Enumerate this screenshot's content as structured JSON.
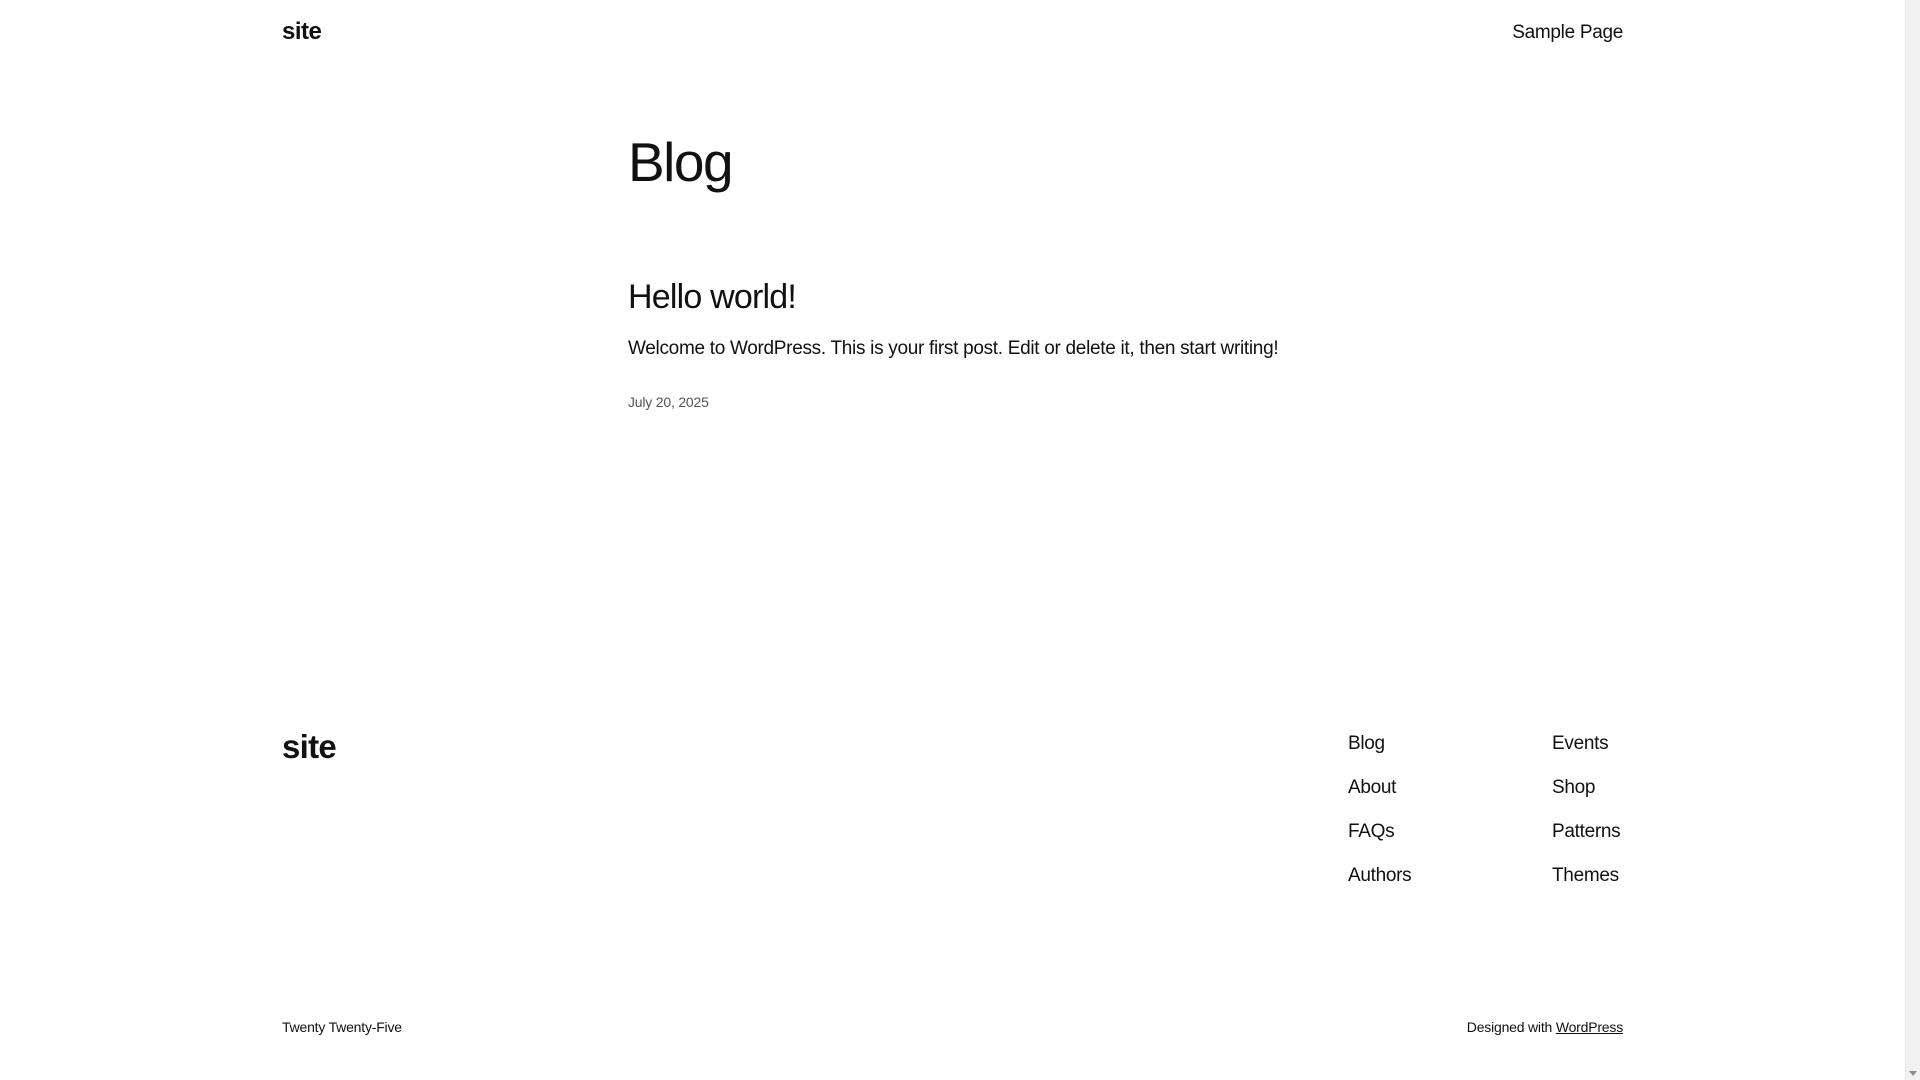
{
  "header": {
    "site_title": "site",
    "nav_item": "Sample Page"
  },
  "main": {
    "heading": "Blog",
    "post": {
      "title": "Hello world!",
      "excerpt": "Welcome to WordPress. This is your first post. Edit or delete it, then start writing!",
      "date": "July 20, 2025"
    }
  },
  "footer": {
    "site_title": "site",
    "nav_col1": [
      "Blog",
      "About",
      "FAQs",
      "Authors"
    ],
    "nav_col2": [
      "Events",
      "Shop",
      "Patterns",
      "Themes"
    ],
    "credit_left": "Twenty Twenty-Five",
    "credit_prefix": "Designed with ",
    "credit_link": "WordPress"
  }
}
